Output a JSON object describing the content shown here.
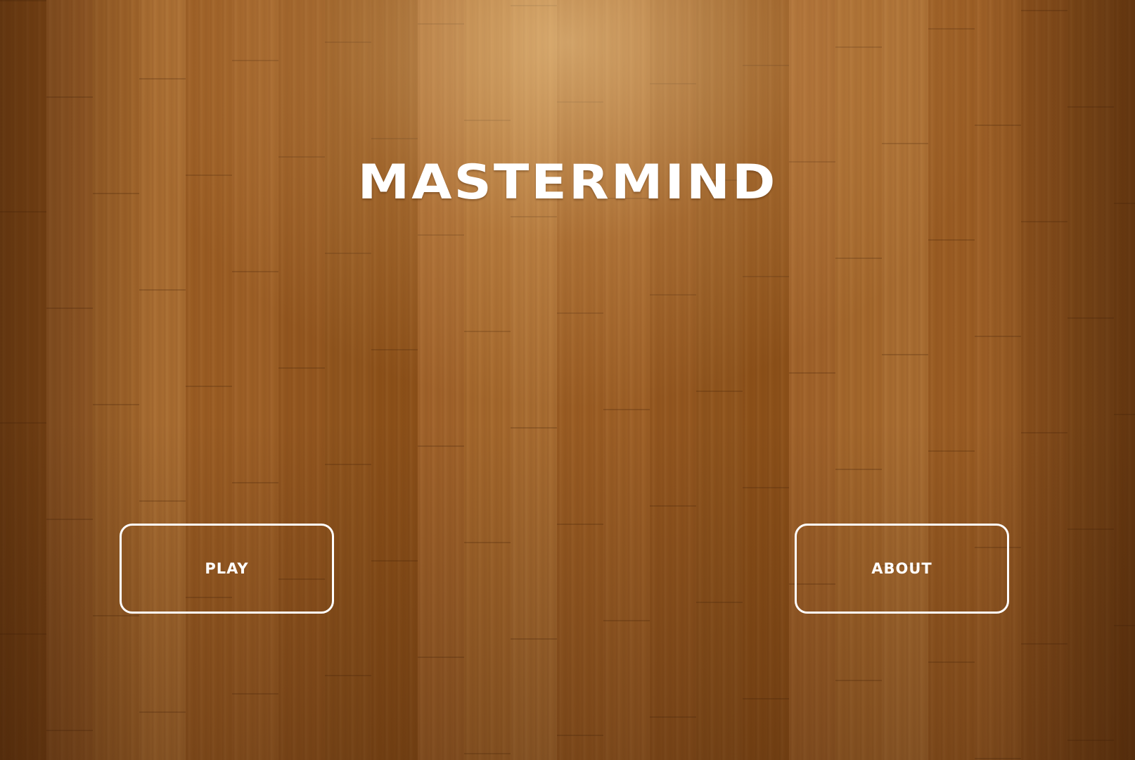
{
  "title": "MASTERMIND",
  "menu": {
    "play_label": "PLAY",
    "about_label": "ABOUT"
  },
  "colors": {
    "wood": "#9a5e22",
    "text": "#ffffff",
    "button_border": "#ffffff"
  }
}
